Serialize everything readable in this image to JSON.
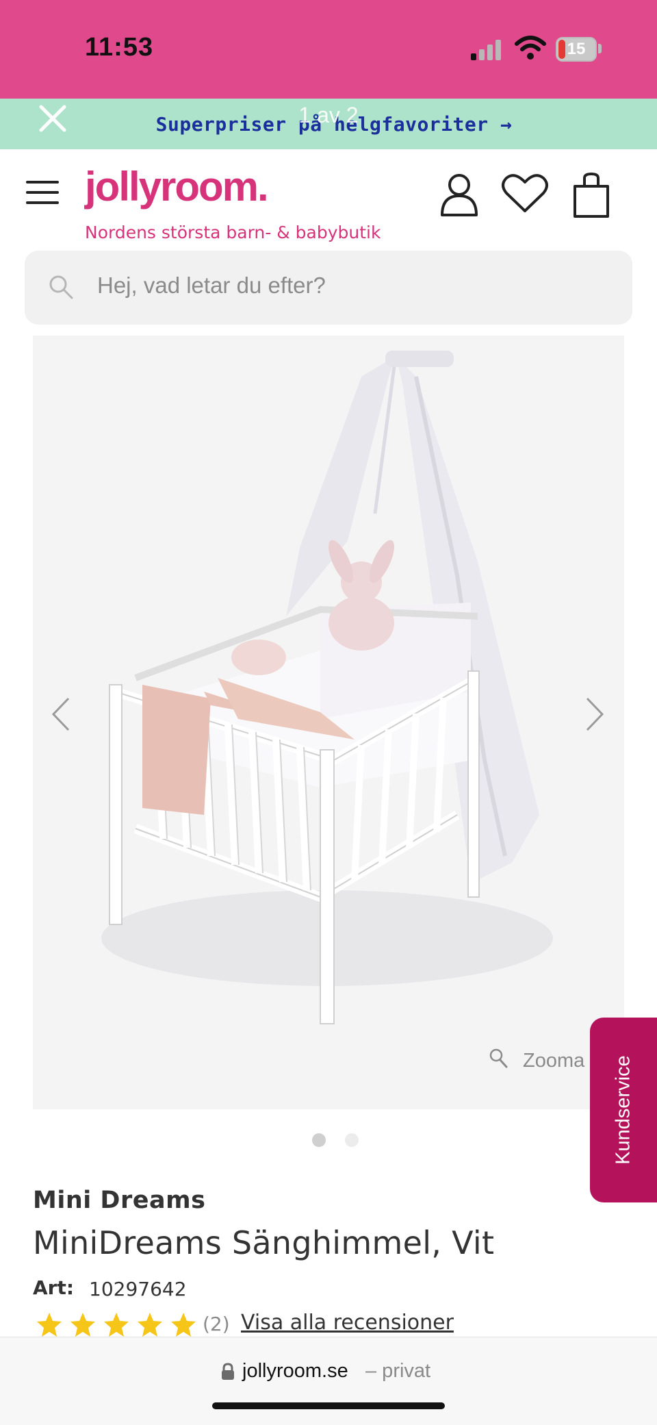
{
  "status_bar": {
    "time": "11:53",
    "battery": "15"
  },
  "promo": {
    "text": "Superpriser på helgfavoriter →",
    "page_indicator": "1 av 2"
  },
  "header": {
    "logo": "jollyroom.",
    "tagline": "Nordens största barn- & babybutik"
  },
  "search": {
    "placeholder": "Hej, vad letar du efter?"
  },
  "gallery": {
    "zoom_label": "Zooma",
    "current_slide": 1,
    "total_slides": 2
  },
  "kundservice": {
    "label": "Kundservice"
  },
  "product": {
    "brand": "Mini Dreams",
    "name": "MiniDreams Sänghimmel, Vit",
    "art_label": "Art:",
    "art_number": "10297642",
    "rating": 5,
    "review_count": "(2)",
    "reviews_link": "Visa alla recensioner"
  },
  "browser": {
    "domain": "jollyroom.se",
    "suffix": "– privat"
  },
  "colors": {
    "status_bar": "#e04a8d",
    "promo_bg": "#aee3cb",
    "promo_text": "#1a2f9c",
    "brand_pink": "#d6337a",
    "kundservice_bg": "#b5125c",
    "star": "#f5c518"
  }
}
